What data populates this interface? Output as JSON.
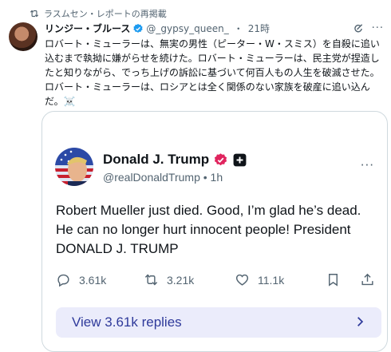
{
  "repost": {
    "text": "ラスムセン・レポートの再掲載"
  },
  "outer_post": {
    "author_name": "リンジー・ブルース",
    "handle": "@_gypsy_queen_",
    "separator": "・",
    "time": "21時",
    "text": "ロバート・ミューラーは、無実の男性（ピーター・W・スミス）を自殺に追い込むまで執拗に嫌がらせを続けた。ロバート・ミューラーは、民主党が捏造したと知りながら、でっち上げの訴訟に基づいて何百人もの人生を破滅させた。ロバート・ミューラーは、ロシアとは全く関係のない家族を破産に追い込んだ。",
    "emoji": "☠️",
    "more": "···"
  },
  "quoted_post": {
    "author_name": "Donald J. Trump",
    "handle": "@realDonaldTrump",
    "separator": "•",
    "time": "1h",
    "text": "Robert Mueller just died. Good, I’m glad he’s dead. He can no longer hurt innocent people! President DONALD J. TRUMP",
    "more": "···",
    "actions": {
      "replies": "3.61k",
      "reposts": "3.21k",
      "likes": "11.1k"
    },
    "view_replies_label": "View 3.61k replies"
  },
  "colors": {
    "verified_blue": "#1d9bf0",
    "verified_pink": "#e0245e",
    "muted_text": "#536471",
    "button_bg": "#ebecfb",
    "button_text": "#2f3a9b"
  }
}
